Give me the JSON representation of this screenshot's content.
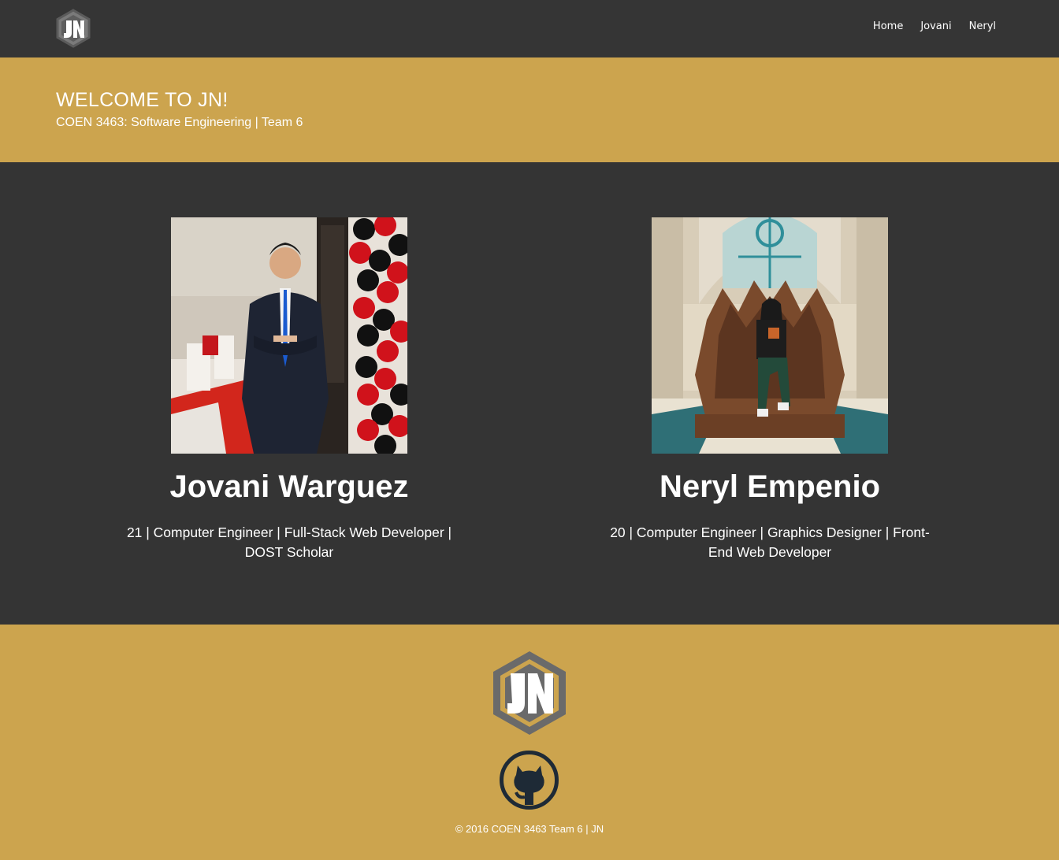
{
  "nav": {
    "logo_icon": "jn-hexagon-logo-icon",
    "links": [
      {
        "label": "Home"
      },
      {
        "label": "Jovani"
      },
      {
        "label": "Neryl"
      }
    ]
  },
  "header": {
    "title": "WELCOME TO JN!",
    "subtitle": "COEN 3463: Software Engineering | Team 6"
  },
  "profiles": [
    {
      "name": "Jovani Warguez",
      "description": "21 | Computer Engineer | Full-Stack Web Developer | DOST Scholar",
      "photo": "photo-man-in-suit-with-balloons"
    },
    {
      "name": "Neryl Empenio",
      "description": "20 | Computer Engineer | Graphics Designer | Front-End Web Developer",
      "photo": "photo-woman-on-iron-throne"
    }
  ],
  "footer": {
    "logo_icon": "jn-hexagon-logo-icon",
    "github_icon": "github-icon",
    "copyright": "© 2016 COEN 3463 Team 6 | JN"
  },
  "colors": {
    "nav_bg": "#353535",
    "accent_gold": "#cca44e",
    "main_bg": "#343434",
    "logo_grey": "#6a6a6a",
    "github_navy": "#1e2a36"
  }
}
